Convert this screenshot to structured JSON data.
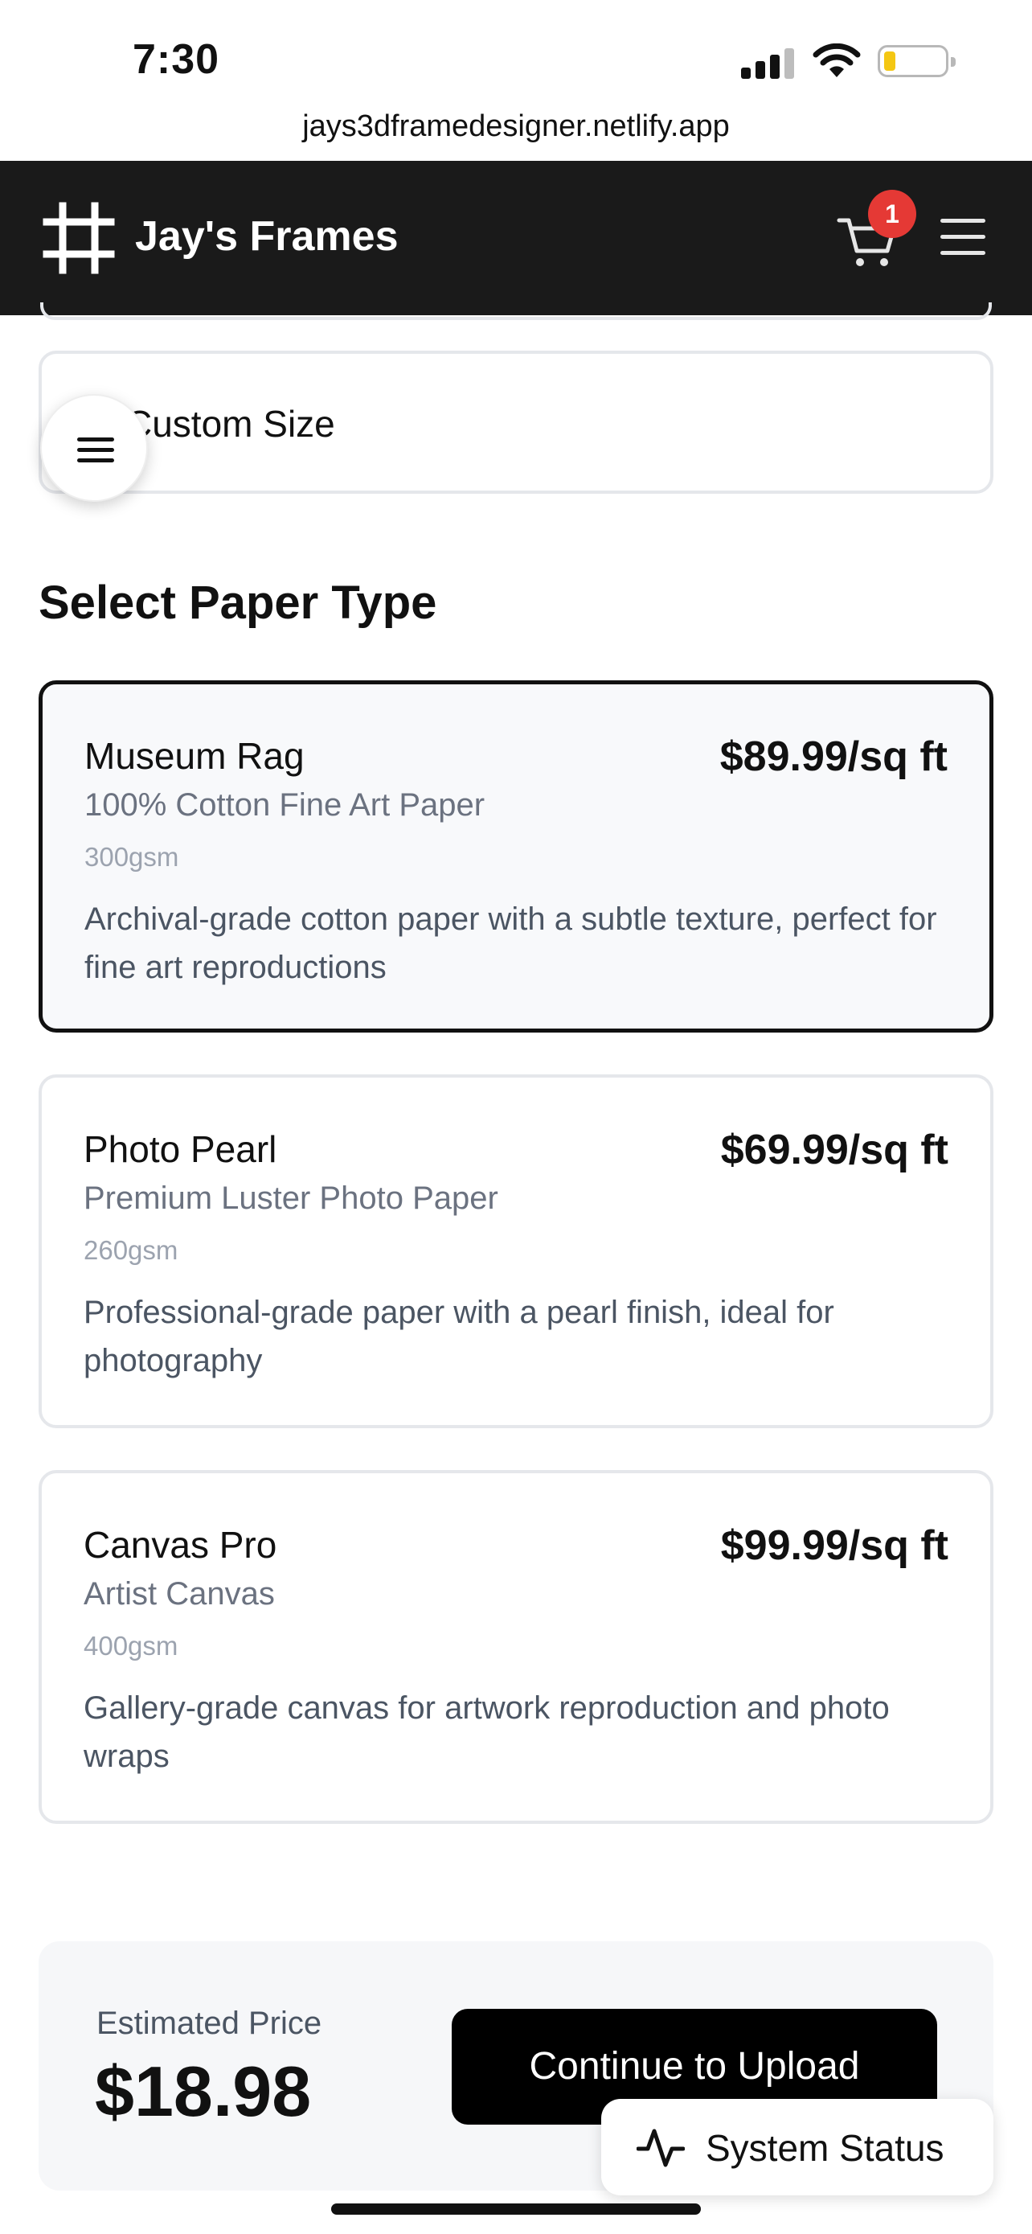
{
  "status_bar": {
    "time": "7:30",
    "battery_color": "#f4c713"
  },
  "browser": {
    "url": "jays3dframedesigner.netlify.app"
  },
  "header": {
    "brand": "Jay's Frames",
    "cart_count": "1",
    "cart_badge_color": "#e53935",
    "icons": [
      "frame-logo-icon",
      "cart-icon",
      "hamburger-menu-icon"
    ]
  },
  "size_options": {
    "custom_label": "Custom Size"
  },
  "paper_section": {
    "title": "Select Paper Type",
    "options": [
      {
        "name": "Museum Rag",
        "price": "$89.99/sq ft",
        "subtitle": "100% Cotton Fine Art Paper",
        "weight": "300gsm",
        "description": "Archival-grade cotton paper with a subtle texture, perfect for fine art reproductions",
        "selected": true
      },
      {
        "name": "Photo Pearl",
        "price": "$69.99/sq ft",
        "subtitle": "Premium Luster Photo Paper",
        "weight": "260gsm",
        "description": "Professional-grade paper with a pearl finish, ideal for photography",
        "selected": false
      },
      {
        "name": "Canvas Pro",
        "price": "$99.99/sq ft",
        "subtitle": "Artist Canvas",
        "weight": "400gsm",
        "description": "Gallery-grade canvas for artwork reproduction and photo wraps",
        "selected": false
      }
    ]
  },
  "summary": {
    "estimated_label": "Estimated Price",
    "estimated_value": "$18.98",
    "continue_label": "Continue to Upload"
  },
  "system_status": {
    "label": "System Status",
    "icon": "activity-pulse-icon"
  }
}
